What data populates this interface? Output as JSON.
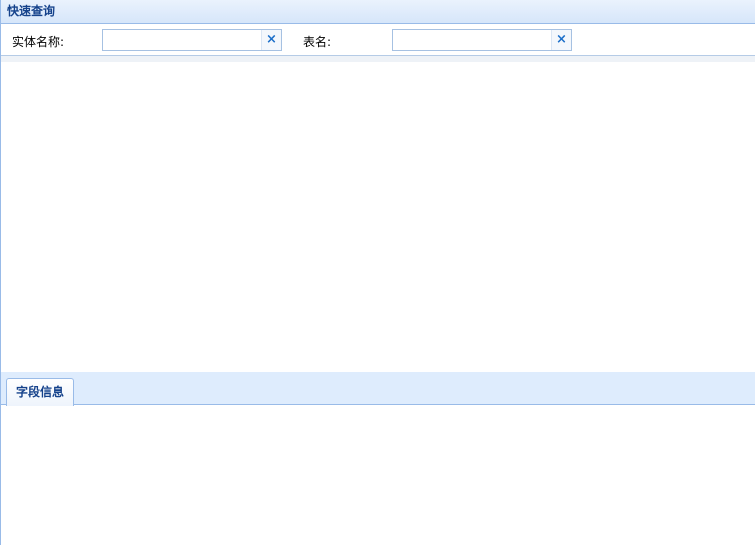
{
  "quick_search": {
    "title": "快速查询",
    "fields": [
      {
        "label": "实体名称:",
        "value": "",
        "placeholder": "",
        "clear_icon": "×"
      },
      {
        "label": "表名:",
        "value": "",
        "placeholder": "",
        "clear_icon": "×"
      }
    ]
  },
  "tabs": [
    {
      "label": "字段信息",
      "active": true
    }
  ],
  "colors": {
    "header_text": "#15428b",
    "border": "#99bbe8",
    "clear_icon": "#1c6fc9",
    "tab_strip_bg": "#deecfd"
  }
}
